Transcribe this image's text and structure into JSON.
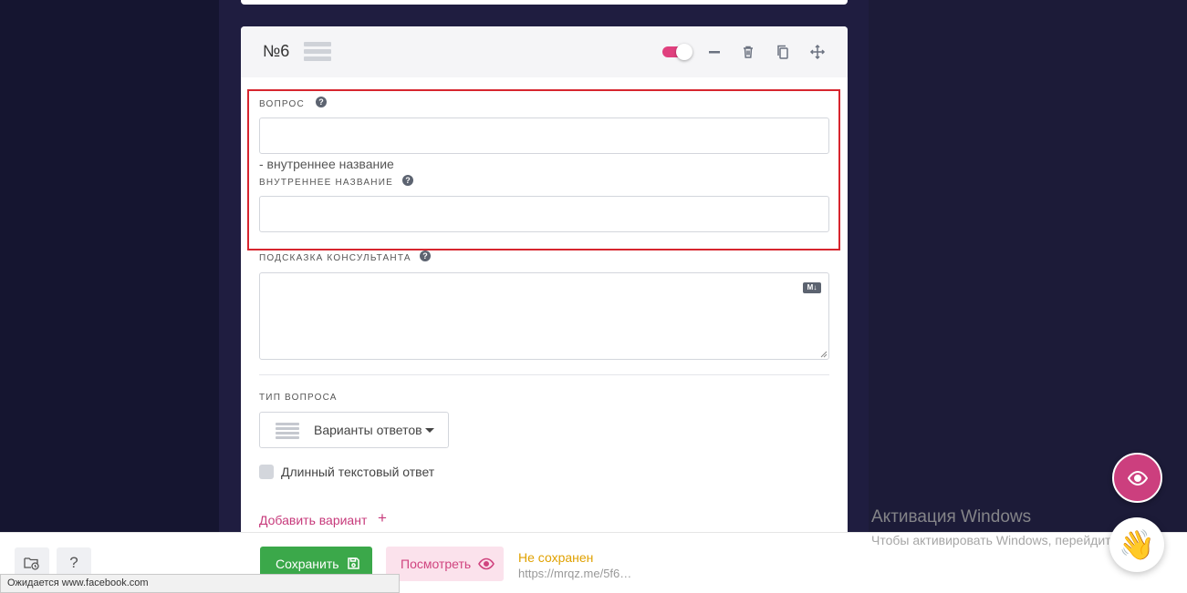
{
  "question_card": {
    "number": "№6",
    "enabled": true,
    "fields": {
      "question": {
        "label": "ВОПРОС",
        "value": "",
        "help": "?"
      },
      "internal_name_hint": "- внутреннее название",
      "internal_name": {
        "label": "ВНУТРЕННЕЕ НАЗВАНИЕ",
        "value": "",
        "help": "?"
      },
      "consultant_hint": {
        "label": "ПОДСКАЗКА КОНСУЛЬТАНТА",
        "value": "",
        "help": "?",
        "badge": "M↓"
      }
    },
    "question_type": {
      "label": "ТИП ВОПРОСА",
      "selected": "Варианты ответов"
    },
    "long_text": {
      "label": "Длинный текстовый ответ",
      "checked": false
    },
    "add_variant": {
      "label": "Добавить вариант",
      "icon": "+"
    }
  },
  "header_icons": [
    "toggle",
    "minus-icon",
    "trash-icon",
    "copy-icon",
    "move-icon"
  ],
  "bottom_bar": {
    "folder_icon": "folder-clock-icon",
    "help_label": "?",
    "save_label": "Сохранить",
    "preview_label": "Посмотреть",
    "status": "Не сохранен",
    "url": "https://mrqz.me/5f6…"
  },
  "browser_status": "Ожидается www.facebook.com",
  "windows_activation": {
    "title": "Активация Windows",
    "text": "Чтобы активировать Windows, перейдите в раздел \"Параметры\"."
  },
  "fab": {
    "eye_icon": "eye-icon",
    "wave_emoji": "👋"
  },
  "colors": {
    "accent": "#cc3f7e",
    "save_green": "#3ba84a",
    "highlight_red": "#d7262f",
    "background": "#1c1b38",
    "status_orange": "#e0a100"
  }
}
